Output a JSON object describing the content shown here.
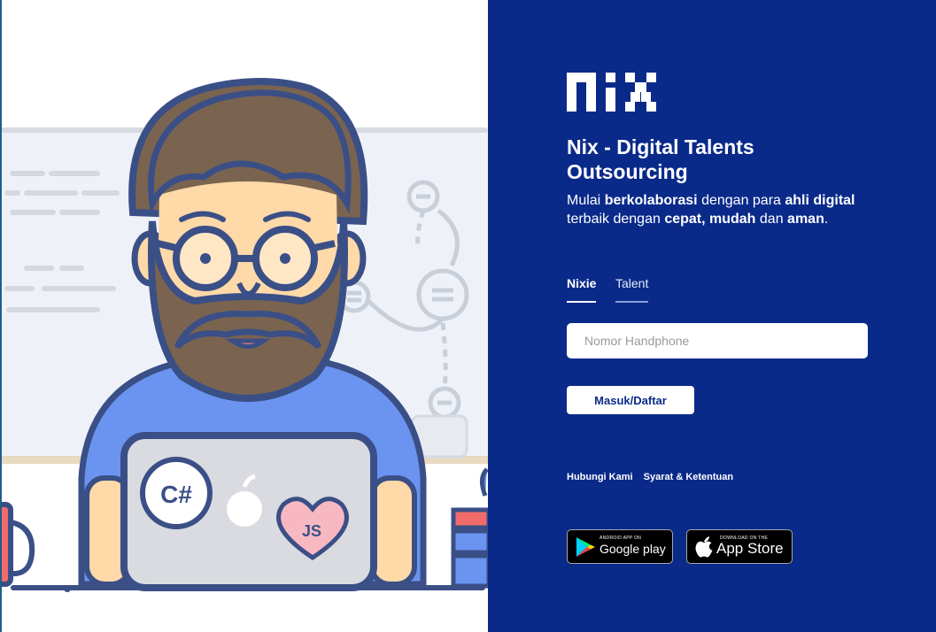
{
  "brand": {
    "logo_text": "NIX",
    "title": "Nix - Digital Talents Outsourcing"
  },
  "tagline": {
    "p1": "Mulai ",
    "b1": "berkolaborasi",
    "p2": " dengan para ",
    "b2": "ahli digital",
    "p3": " terbaik dengan ",
    "b3": "cepat, mudah",
    "p4": " dan ",
    "b4": "aman",
    "p5": "."
  },
  "tabs": [
    {
      "label": "Nixie",
      "active": true
    },
    {
      "label": "Talent",
      "active": false
    }
  ],
  "form": {
    "phone_placeholder": "Nomor Handphone",
    "phone_value": "",
    "submit_label": "Masuk/Daftar"
  },
  "footer_links": [
    {
      "label": "Hubungi Kami"
    },
    {
      "label": "Syarat & Ketentuan"
    }
  ],
  "stores": {
    "google": {
      "small": "ANDROID APP ON",
      "big": "Google play",
      "icon": "google-play-icon"
    },
    "apple": {
      "small": "DOWNLOAD ON THE",
      "big": "App Store",
      "icon": "apple-icon"
    }
  },
  "illustration": {
    "laptop_sticker_1": "C#",
    "laptop_sticker_2": "JS"
  },
  "colors": {
    "panel": "#0a2a8a",
    "skin": "#ffd9a8",
    "beard": "#7a6450",
    "shirt": "#6b94f0",
    "outline": "#3b4f87"
  }
}
